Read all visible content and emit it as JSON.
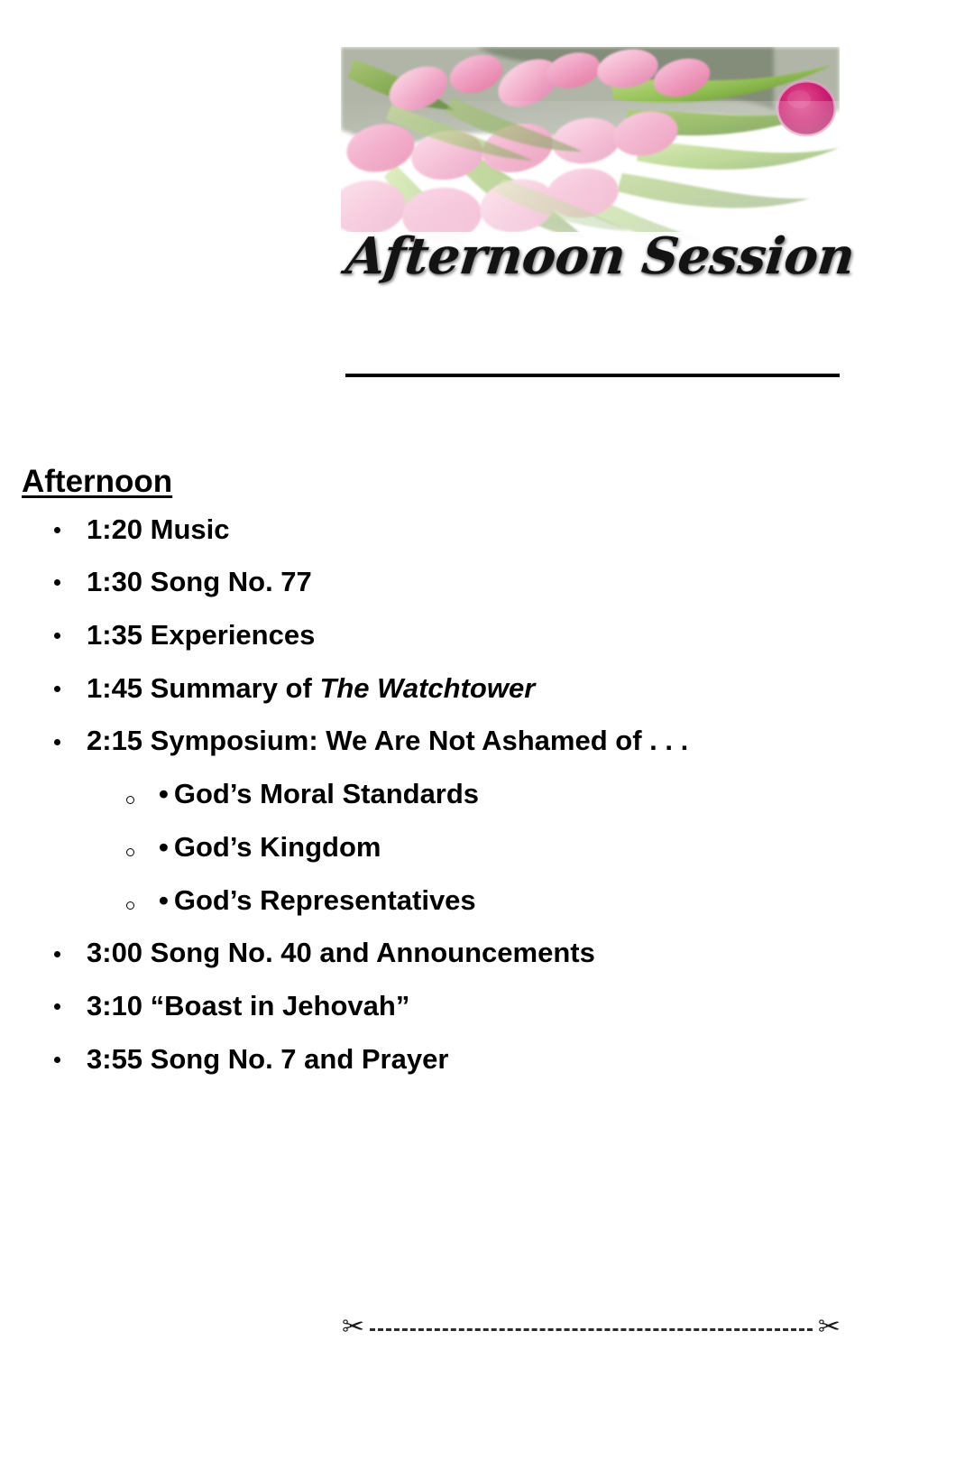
{
  "header": {
    "image_alt": "pink-tulips-photo",
    "banner_title": "Afternoon Session",
    "accent_pink": "#f0a3c0",
    "accent_magenta": "#c9196e",
    "accent_green": "#8cb84a",
    "rule_color": "#000000"
  },
  "schedule": {
    "heading": "Afternoon",
    "items": [
      {
        "time": "1:20",
        "text": "1:20 Music"
      },
      {
        "time": "1:30",
        "text": "1:30 Song No. 77"
      },
      {
        "time": "1:35",
        "text": "1:35 Experiences"
      },
      {
        "time": "1:45",
        "text_prefix": "1:45 Summary of ",
        "text_italic": "The Watchtower"
      },
      {
        "time": "2:15",
        "text": "2:15 Symposium: We Are Not Ashamed of . . .",
        "subitems": [
          {
            "marker": "•",
            "text": "God’s Moral Standards"
          },
          {
            "marker": "•",
            "text": "God’s Kingdom"
          },
          {
            "marker": "•",
            "text": "God’s Representatives"
          }
        ]
      },
      {
        "time": "3:00",
        "text": "3:00 Song No. 40 and Announcements"
      },
      {
        "time": "3:10",
        "text": "3:10 “Boast in Jehovah”"
      },
      {
        "time": "3:55",
        "text": "3:55 Song No. 7 and Prayer"
      }
    ]
  },
  "footer": {
    "scissors_left": "✂",
    "scissors_right": "✂",
    "glyph_name": "scissors-icon"
  }
}
